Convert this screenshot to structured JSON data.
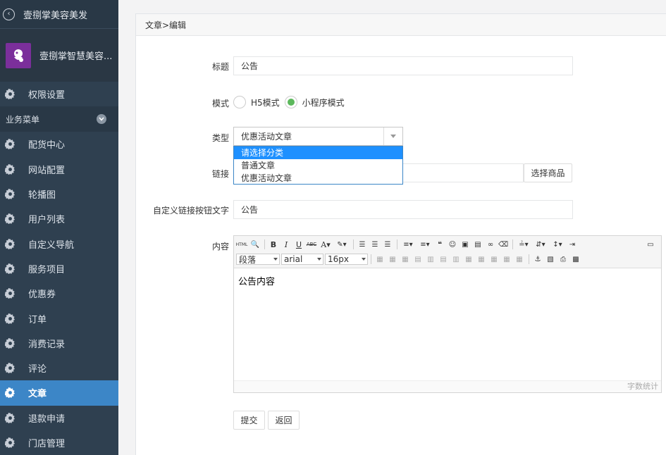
{
  "sidebar": {
    "top_title": "壹捌掌美容美发",
    "profile_name": "壹捌掌智慧美容...",
    "permission_label": "权限设置",
    "section_label": "业务菜单",
    "items": [
      {
        "label": "配货中心"
      },
      {
        "label": "网站配置"
      },
      {
        "label": "轮播图"
      },
      {
        "label": "用户列表"
      },
      {
        "label": "自定义导航"
      },
      {
        "label": "服务项目"
      },
      {
        "label": "优惠券"
      },
      {
        "label": "订单"
      },
      {
        "label": "消费记录"
      },
      {
        "label": "评论"
      },
      {
        "label": "文章",
        "active": true
      },
      {
        "label": "退款申请"
      },
      {
        "label": "门店管理"
      }
    ]
  },
  "panel": {
    "breadcrumb": "文章>编辑"
  },
  "form": {
    "title_label": "标题",
    "title_value": "公告",
    "mode_label": "模式",
    "mode_h5": "H5模式",
    "mode_mini": "小程序模式",
    "type_label": "类型",
    "type_value": "优惠活动文章",
    "type_options": [
      "请选择分类",
      "普通文章",
      "优惠活动文章"
    ],
    "link_label": "链接",
    "select_goods": "选择商品",
    "custom_btn_label": "自定义链接按钮文字",
    "custom_btn_value": "公告",
    "content_label": "内容",
    "content_value": "公告内容",
    "word_count": "字数统计",
    "submit": "提交",
    "back": "返回"
  },
  "editor": {
    "paragraph": "段落",
    "font": "arial",
    "size": "16px"
  }
}
